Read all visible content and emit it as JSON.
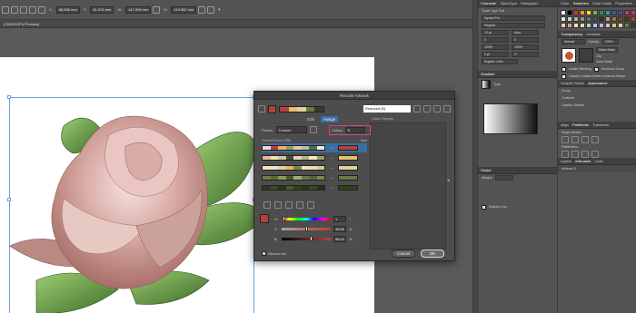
{
  "control_bar": {
    "x_label": "X:",
    "x_value": "88.666 mm",
    "y_label": "Y:",
    "y_value": "81.578 mm",
    "w_label": "W:",
    "w_value": "147.999 mm",
    "h_label": "H:",
    "h_value": "119.952 mm"
  },
  "document_tab": "(CMYK/GPU Preview)",
  "dialog": {
    "title": "Recolor Artwork",
    "preset_name_field": "Reduced (5)",
    "tab_edit": "Edit",
    "tab_assign": "Assign",
    "preset_label": "Preset:",
    "preset_value": "Custom",
    "colors_label": "Colors:",
    "colors_value": "5",
    "color_groups_label": "Color Groups",
    "current_colors_label": "Current Colors (786)",
    "new_label": "New",
    "rows": [
      {
        "current": [
          "#f2d8c6",
          "#cc3a3a",
          "#f0b35e",
          "#8fa25f",
          "#e8c5a6",
          "#c0b8a0",
          "#5e6f3b",
          "#f6e9d9"
        ],
        "new": "#b4433b",
        "selected": true
      },
      {
        "current": [
          "#e8b4a4",
          "#f4e0a8",
          "#c9c7a8",
          "#4a4a3a",
          "#e8d4b8",
          "#b1b58a",
          "#f6e9c0",
          "#9da06a"
        ],
        "new": "#e8c06a",
        "selected": false
      },
      {
        "current": [
          "#f5e7b9",
          "#ece0c8",
          "#e6d29c",
          "#f0b35e",
          "#7c8753",
          "#efe3c3",
          "#eadbb2",
          "#d9c68f"
        ],
        "new": "#e0d2a0",
        "selected": false
      },
      {
        "current": [
          "#6e7d49",
          "#5a6a38",
          "#8a9a5e",
          "#4d5c2e",
          "#9fae72",
          "#6a7a44",
          "#55653a",
          "#7a8a50"
        ],
        "new": "#6a7a44",
        "selected": false
      },
      {
        "current": [
          "#2f3a1c",
          "#3d4a26",
          "#28341a",
          "#4a5a2c",
          "#33401f",
          "#2a3518",
          "#3a4722",
          "#26301a"
        ],
        "new": "#33401f",
        "selected": false
      }
    ],
    "sliders": [
      {
        "label": "H",
        "value": "1",
        "unit": "°",
        "position": 0.02,
        "track": "linear-gradient(90deg,#f00,#ff0,#0f0,#0ff,#00f,#f0f,#f00)"
      },
      {
        "label": "S",
        "value": "48.65",
        "unit": "%",
        "position": 0.49,
        "track": "linear-gradient(90deg,#a5a5a5,#c03a32)"
      },
      {
        "label": "B",
        "value": "58.04",
        "unit": "%",
        "position": 0.58,
        "track": "linear-gradient(90deg,#000,#b4433b)"
      }
    ],
    "recolor_art_label": "Recolor Art",
    "cancel_label": "Cancel",
    "ok_label": "OK",
    "colors": {
      "accent": "#3a6ea5",
      "colors_highlight": "#e43a8c",
      "selected_swatch": "#b4433b"
    }
  },
  "panels": {
    "char_tabs": [
      "Character",
      "OpenType",
      "Paragraph"
    ],
    "touch_type_tool": "Touch Type Tool",
    "font_family": "Myriad Pro",
    "font_style": "Regular",
    "font_size": "12 pt",
    "leading": "Auto",
    "kerning": "0",
    "tracking": "0",
    "vertical_scale": "100%",
    "horizontal_scale": "100%",
    "baseline_shift": "0 pt",
    "rotation": "0°",
    "language": "English: USA",
    "gradient_tab": "Gradient",
    "gradient_type_label": "Type:",
    "stroke_tab": "Stroke",
    "weight_label": "Weight:",
    "dashed_line_label": "Dashed Line",
    "color_tabs": [
      "Color",
      "Swatches",
      "Color Guide",
      "Properties"
    ],
    "transparency_tabs": [
      "Transparency",
      "Libraries"
    ],
    "blend_mode": "Normal",
    "opacity_label": "Opacity:",
    "opacity_value": "100%",
    "make_mask": "Make Mask",
    "clip_label": "Clip",
    "invert_mask": "Invert Mask",
    "isolate_blending": "Isolate Blending",
    "knockout_group": "Knockout Group",
    "opacity_mask_define": "Opacity & Mask Define Knockout Shape",
    "appearance_tabs": [
      "Graphic Styles",
      "Appearance"
    ],
    "appearance_group": "Group",
    "appearance_contents": "Contents",
    "appearance_opacity": "Opacity: Default",
    "align_tabs": [
      "Align",
      "Pathfinder",
      "Transform"
    ],
    "shape_modes": "Shape Modes:",
    "pathfinders": "Pathfinders:",
    "layers_tabs": [
      "Layers",
      "Artboards",
      "Links"
    ],
    "artboard_item": "Artboard 1"
  }
}
